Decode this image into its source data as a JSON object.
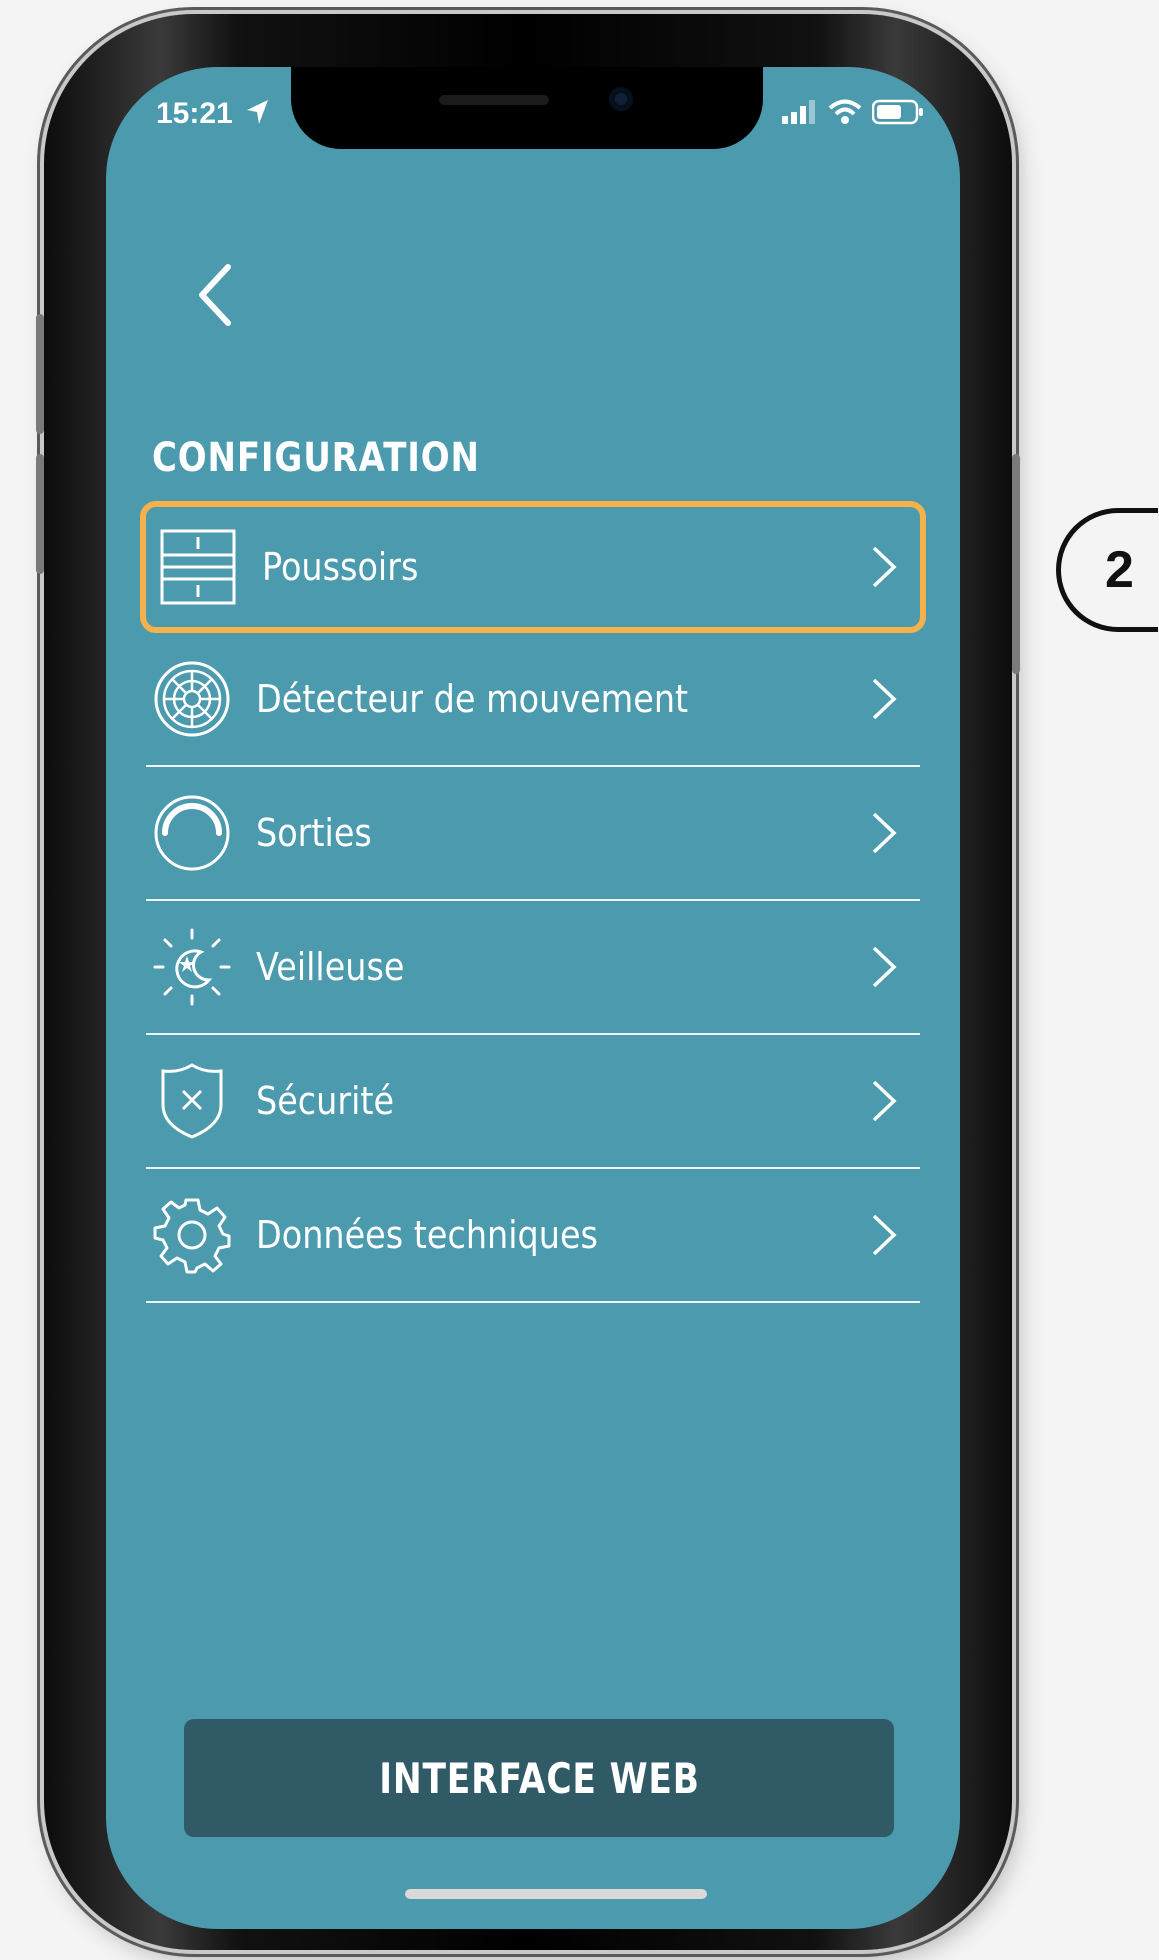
{
  "status_bar": {
    "time": "15:21"
  },
  "header": {
    "section_title": "CONFIGURATION"
  },
  "menu": {
    "items": [
      {
        "label": "Poussoirs",
        "icon": "push-buttons-icon"
      },
      {
        "label": "Détecteur de mouvement",
        "icon": "motion-sensor-icon"
      },
      {
        "label": "Sorties",
        "icon": "outputs-dial-icon"
      },
      {
        "label": "Veilleuse",
        "icon": "night-light-icon"
      },
      {
        "label": "Sécurité",
        "icon": "security-shield-icon"
      },
      {
        "label": "Données techniques",
        "icon": "gear-icon"
      }
    ]
  },
  "footer": {
    "web_button_label": "INTERFACE WEB"
  },
  "annotation": {
    "step_number": "2"
  },
  "colors": {
    "screen_bg": "#4b9aae",
    "highlight": "#f6b24a",
    "button_bg": "#2f5a66"
  }
}
